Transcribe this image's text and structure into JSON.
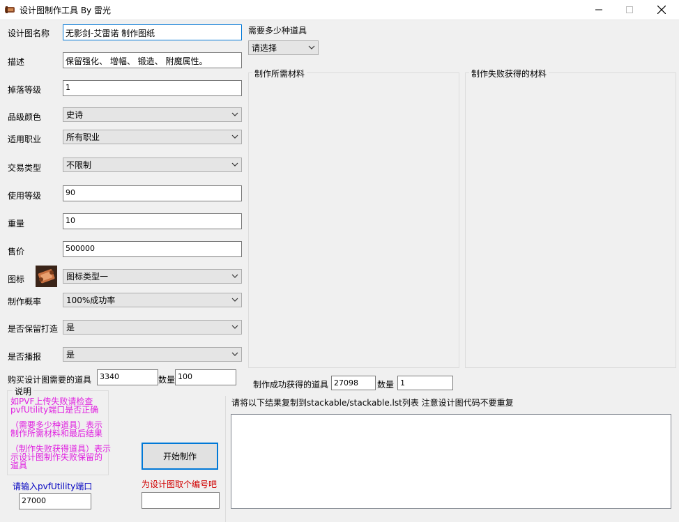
{
  "window": {
    "title": "设计图制作工具    By 雷光"
  },
  "fields": {
    "name_label": "设计图名称",
    "name_value": "无影剑-艾雷诺 制作图纸",
    "desc_label": "描述",
    "desc_value": "保留强化、 增幅、 锻造、 附魔属性。",
    "drop_label": "掉落等级",
    "drop_value": "1",
    "grade_label": "品级颜色",
    "grade_value": "史诗",
    "job_label": "适用职业",
    "job_value": "所有职业",
    "trade_label": "交易类型",
    "trade_value": "不限制",
    "uselevel_label": "使用等级",
    "uselevel_value": "90",
    "weight_label": "重量",
    "weight_value": "10",
    "price_label": "售价",
    "price_value": "500000",
    "icon_label": "图标",
    "icon_value": "图标类型一",
    "prob_label": "制作概率",
    "prob_value": "100%成功率",
    "keep_label": "是否保留打造",
    "keep_value": "是",
    "broadcast_label": "是否播报",
    "broadcast_value": "是",
    "buy_label": "购买设计图需要的道具",
    "buy_item": "3340",
    "qty_label": "数量",
    "buy_qty": "100"
  },
  "right": {
    "kinds_label": "需要多少种道具",
    "kinds_value": "请选择",
    "materials_title": "制作所需材料",
    "fail_title": "制作失败获得的材料",
    "success_label": "制作成功获得的道具",
    "success_item": "27098",
    "qty_label": "数量",
    "success_qty": "1",
    "copy_hint": "请将以下结果复制到stackable/stackable.lst列表    注意设计图代码不要重复"
  },
  "notes": {
    "title": "说明",
    "line1a": "如PVF上传失败请检查",
    "line1b": "pvfUtility端口是否正确",
    "line2a": "（需要多少种道具）表示",
    "line2b": "制作所需材料和最后结果",
    "line3a": "（制作失败获得道具）表示",
    "line3b": "示设计图制作失败保留的",
    "line3c": "道具"
  },
  "bottom": {
    "start_button": "开始制作",
    "port_label": "请输入pvfUtility端口",
    "port_value": "27000",
    "code_label": "为设计图取个编号吧",
    "code_value": ""
  },
  "colors": {
    "accent": "#0078d7",
    "note_text": "#e020e0",
    "port_label": "#0000c0",
    "code_label": "#d00000"
  }
}
